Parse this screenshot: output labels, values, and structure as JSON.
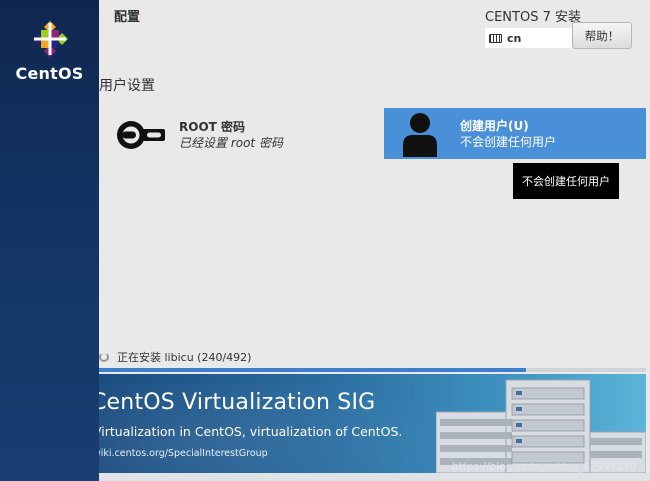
{
  "sidebar": {
    "logo_text": "CentOS"
  },
  "header": {
    "page_title": "配置",
    "install_title": "CENTOS 7 安装",
    "keyboard_layout": "cn",
    "help_label": "帮助！"
  },
  "section": {
    "title": "用户设置"
  },
  "spokes": {
    "root": {
      "label": "ROOT 密码",
      "status": "已经设置 root 密码",
      "icon": "key-icon"
    },
    "user": {
      "label": "创建用户(U)",
      "status": "不会创建任何用户",
      "icon": "user-icon",
      "selected": true
    }
  },
  "tooltip": {
    "text": "不会创建任何用户"
  },
  "progress": {
    "text": "正在安装 libicu (240/492)",
    "fraction": 0.78
  },
  "banner": {
    "title": "CentOS Virtualization SIG",
    "subtitle": "Virtualization in CentOS, virtualization of CentOS.",
    "url": "wiki.centos.org/SpecialInterestGroup"
  },
  "watermark": "https://blog.csdn.net/qq_42993230",
  "colors": {
    "sidebar": "#143769",
    "selected_spoke": "#4a90d9",
    "progress": "#3f7fc9"
  }
}
